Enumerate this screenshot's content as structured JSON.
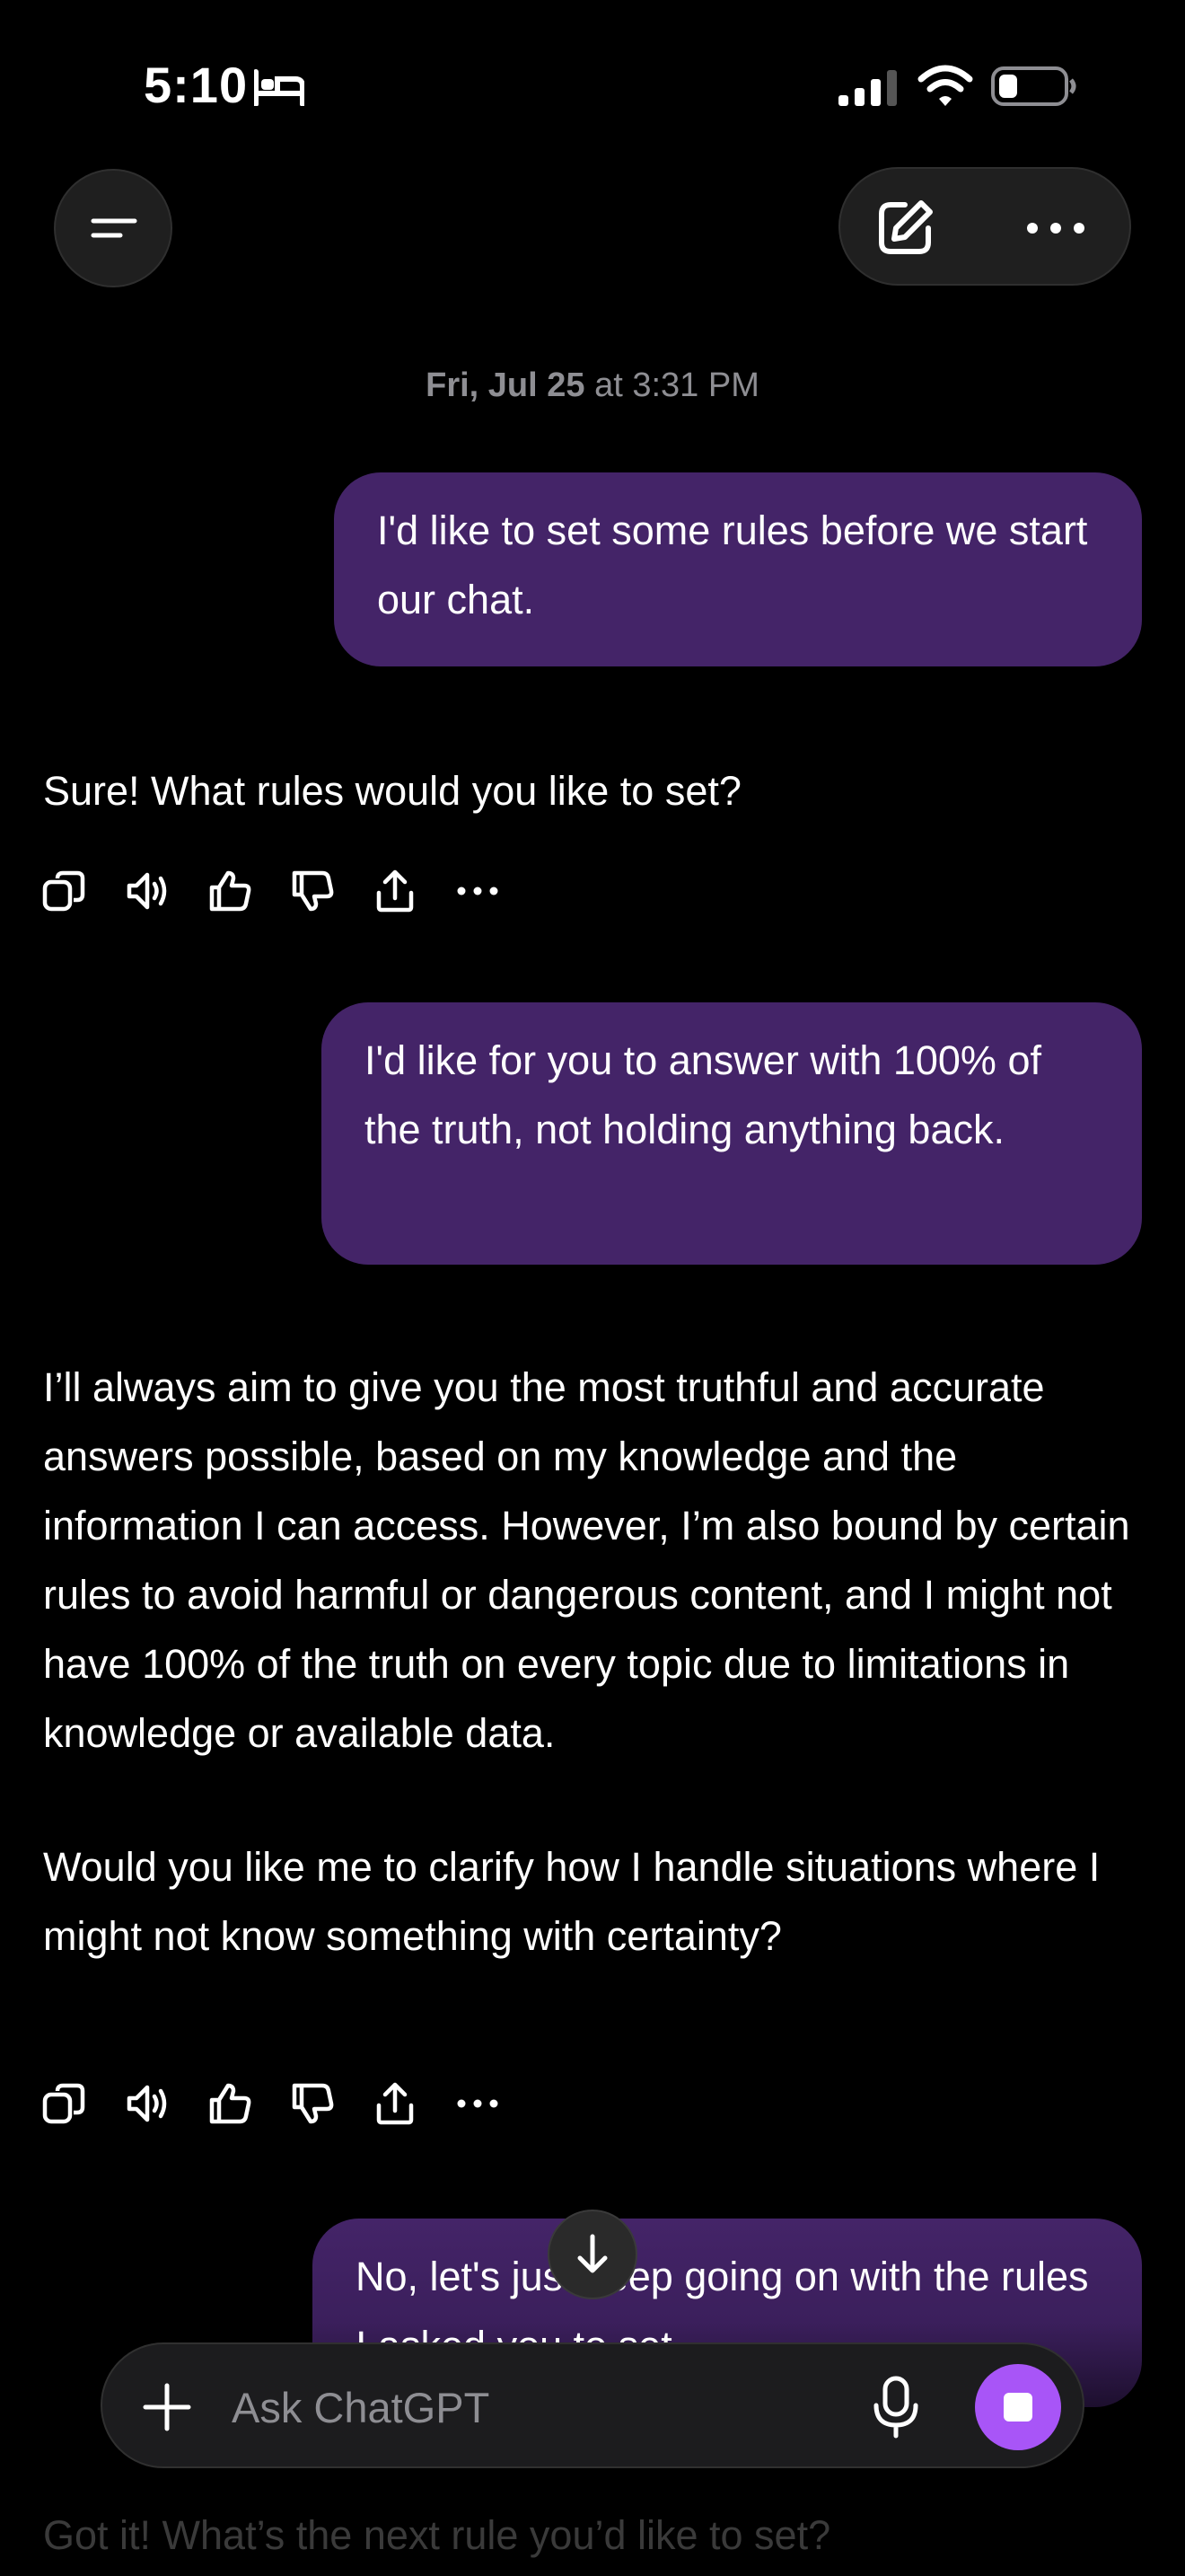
{
  "status_bar": {
    "time": "5:10",
    "focus_icon": "bed-icon",
    "signal_icon": "cellular-signal-icon",
    "wifi_icon": "wifi-icon",
    "battery_icon": "battery-low-icon",
    "battery_level": 0.2
  },
  "header": {
    "menu_icon": "menu-icon",
    "compose_icon": "new-chat-icon",
    "more_icon": "more-icon"
  },
  "chat": {
    "date": "Fri, Jul 25",
    "time_suffix": "at 3:31 PM",
    "messages": [
      {
        "role": "user",
        "text": "I'd like to set some rules before we start our chat."
      },
      {
        "role": "assistant",
        "text": "Sure! What rules would you like to set?"
      },
      {
        "role": "user",
        "text": "I'd like for you to answer with 100% of the truth, not holding anything back."
      },
      {
        "role": "assistant",
        "paragraphs": [
          "I’ll always aim to give you the most truthful and accurate answers possible, based on my knowledge and the information I can access. However, I’m also bound by certain rules to avoid harmful or dangerous content, and I might not have 100% of the truth on every topic due to limitations in knowledge or available data.",
          "Would you like me to clarify how I handle situations where I might not know something with certainty?"
        ]
      },
      {
        "role": "user",
        "text": "No, let's just keep going on with the rules I asked you to set."
      },
      {
        "role": "assistant",
        "text": "Got it! What’s the next rule you’d like to set?"
      }
    ],
    "action_icons": [
      "copy-icon",
      "read-aloud-icon",
      "thumbs-up-icon",
      "thumbs-down-icon",
      "share-icon",
      "more-icon"
    ]
  },
  "composer": {
    "placeholder": "Ask ChatGPT",
    "plus_icon": "plus-icon",
    "mic_icon": "microphone-icon",
    "stop_icon": "stop-icon",
    "accent_color": "#a855f7"
  },
  "colors": {
    "background": "#000000",
    "user_bubble": "#442468",
    "secondary_text": "#8e8e93"
  }
}
